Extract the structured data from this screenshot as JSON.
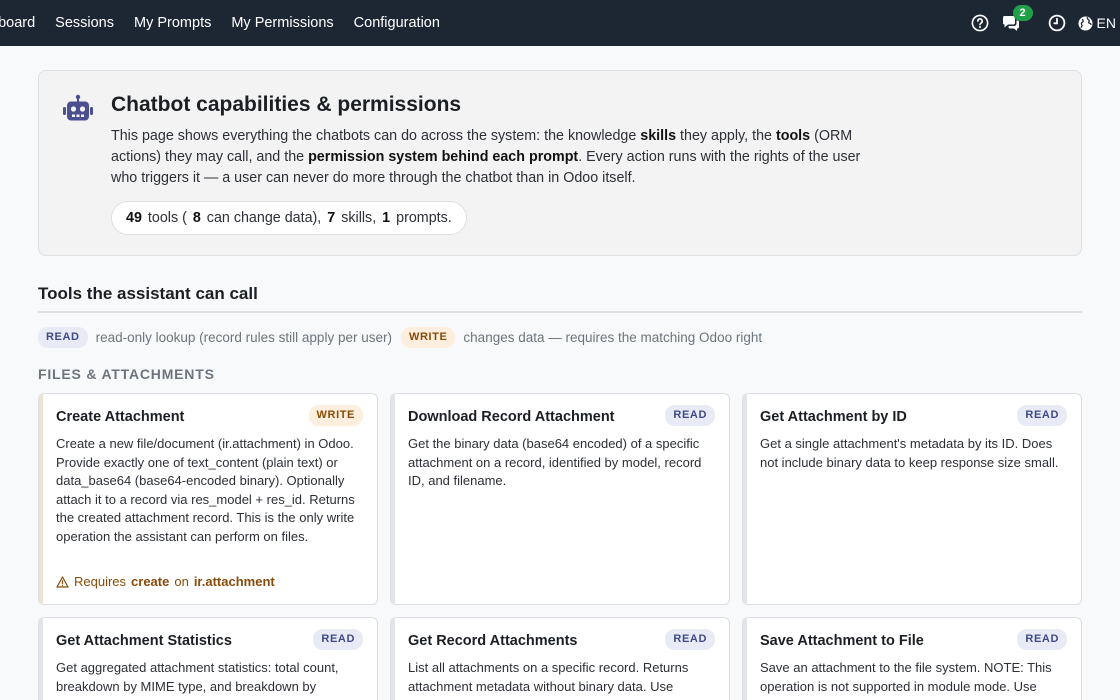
{
  "nav": {
    "links": [
      "hboard",
      "Sessions",
      "My Prompts",
      "My Permissions",
      "Configuration"
    ],
    "chat_count": "2",
    "lang": "EN",
    "icons": [
      "help-icon",
      "chat-icon",
      "clock-icon",
      "globe-icon"
    ]
  },
  "hero": {
    "title": "Chatbot capabilities & permissions",
    "desc_1": "This page shows everything the chatbots can do across the system: the knowledge ",
    "desc_skills": "skills",
    "desc_2": " they apply, the ",
    "desc_tools": "tools",
    "desc_3": " (ORM actions) they may call, and the ",
    "desc_perm": "permission system behind each prompt",
    "desc_4": ". Every action runs with the rights of the user who triggers it — a user can never do more through the chatbot than in Odoo itself.",
    "stats": {
      "tools": "49",
      "tools_label": "tools (",
      "changing": "8",
      "changing_label": "can change data),",
      "skills": "7",
      "skills_label": "skills,",
      "prompts": "1",
      "prompts_label": "prompts."
    }
  },
  "tools_section": {
    "title": "Tools the assistant can call",
    "legend": {
      "read_badge": "READ",
      "read_text": "read-only lookup (record rules still apply per user)",
      "write_badge": "WRITE",
      "write_text": "changes data — requires the matching Odoo right"
    },
    "category": "FILES & ATTACHMENTS",
    "cards": [
      {
        "title": "Create Attachment",
        "badge": "WRITE",
        "desc": "Create a new file/document (ir.attachment) in Odoo. Provide exactly one of text_content (plain text) or data_base64 (base64-encoded binary). Optionally attach it to a record via res_model + res_id. Returns the created attachment record. This is the only write operation the assistant can perform on files.",
        "req_prefix": "Requires",
        "req_right": "create",
        "req_on": "on",
        "req_model": "ir.attachment"
      },
      {
        "title": "Download Record Attachment",
        "badge": "READ",
        "desc": "Get the binary data (base64 encoded) of a specific attachment on a record, identified by model, record ID, and filename."
      },
      {
        "title": "Get Attachment by ID",
        "badge": "READ",
        "desc": "Get a single attachment's metadata by its ID. Does not include binary data to keep response size small."
      },
      {
        "title": "Get Attachment Statistics",
        "badge": "READ",
        "desc": "Get aggregated attachment statistics: total count, breakdown by MIME type, and breakdown by"
      },
      {
        "title": "Get Record Attachments",
        "badge": "READ",
        "desc": "List all attachments on a specific record. Returns attachment metadata without binary data. Use"
      },
      {
        "title": "Save Attachment to File",
        "badge": "READ",
        "desc": "Save an attachment to the file system. NOTE: This operation is not supported in module mode. Use"
      }
    ]
  }
}
